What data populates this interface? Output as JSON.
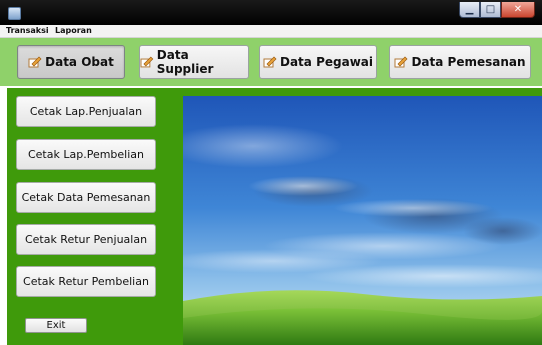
{
  "menu": {
    "items": [
      "Transaksi",
      "Laporan"
    ]
  },
  "toolbar": {
    "buttons": [
      {
        "label": "Data Obat",
        "icon": "edit-icon"
      },
      {
        "label": "Data Supplier",
        "icon": "edit-icon"
      },
      {
        "label": "Data Pegawai",
        "icon": "edit-icon"
      },
      {
        "label": "Data Pemesanan",
        "icon": "edit-icon"
      }
    ]
  },
  "sidebar": {
    "buttons": [
      "Cetak Lap.Penjualan",
      "Cetak Lap.Pembelian",
      "Cetak Data Pemesanan",
      "Cetak Retur Penjualan",
      "Cetak Retur Pembelian"
    ],
    "exit_label": "Exit"
  },
  "colors": {
    "toolbar_bg": "#8fd16a",
    "panel_green": "#3f9a0b"
  },
  "wallpaper": {
    "icon": "sky-meadow-image"
  }
}
